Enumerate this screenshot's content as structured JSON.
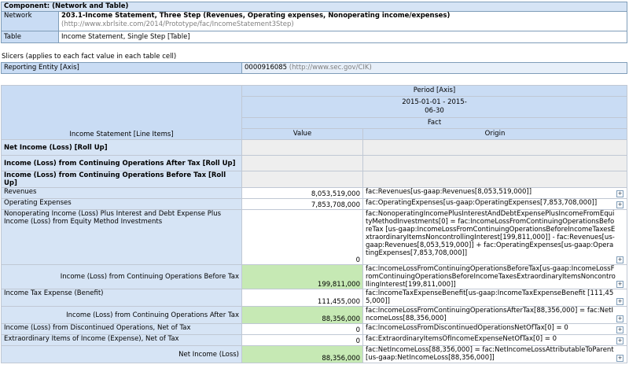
{
  "component": {
    "header": "Component: (Network and Table)",
    "network_label": "Network",
    "network_title": "203.1-Income Statement, Three Step (Revenues, Operating expenses, Nonoperating income/expenses)",
    "network_url": "(http://www.xbrlsite.com/2014/Prototype/fac/IncomeStatement3Step)",
    "table_label": "Table",
    "table_value": "Income Statement, Single Step [Table]"
  },
  "slicers": {
    "caption": "Slicers (applies to each fact value in each table cell)",
    "axis_label": "Reporting Entity [Axis]",
    "axis_value": "0000916085",
    "axis_value_url": "(http://www.sec.gov/CIK)"
  },
  "grid": {
    "period_axis": "Period [Axis]",
    "period_value": "2015-01-01 - 2015-06-30",
    "fact_label": "Fact",
    "line_items_label": "Income Statement [Line Items]",
    "value_col": "Value",
    "origin_col": "Origin",
    "rows": [
      {
        "label": "Net Income (Loss) [Roll Up]",
        "bold": true,
        "abstract": true,
        "value": "",
        "origin": ""
      },
      {
        "label": "Income (Loss) from Continuing Operations After Tax [Roll Up]",
        "bold": true,
        "abstract": true,
        "value": "",
        "origin": ""
      },
      {
        "label": "Income (Loss) from Continuing Operations Before Tax [Roll Up]",
        "bold": true,
        "abstract": true,
        "value": "",
        "origin": ""
      },
      {
        "label": "Revenues",
        "value": "8,053,519,000",
        "origin": "fac:Revenues[us-gaap:Revenues[8,053,519,000]]"
      },
      {
        "label": "Operating Expenses",
        "value": "7,853,708,000",
        "origin": "fac:OperatingExpenses[us-gaap:OperatingExpenses[7,853,708,000]]"
      },
      {
        "label": "Nonoperating Income (Loss) Plus Interest and Debt Expense Plus Income (Loss) from Equity Method Investments",
        "value": "0",
        "origin": "fac:NonoperatingIncomePlusInterestAndDebtExpensePlusIncomeFromEquityMethodInvestments[0] = fac:IncomeLossFromContinuingOperationsBeforeTax [us-gaap:IncomeLossFromContinuingOperationsBeforeIncomeTaxesExtraordinaryItemsNoncontrollingInterest[199,811,000]] - fac:Revenues[us-gaap:Revenues[8,053,519,000]] + fac:OperatingExpenses[us-gaap:OperatingExpenses[7,853,708,000]]"
      },
      {
        "label": "Income (Loss) from Continuing Operations Before Tax",
        "indent": true,
        "total": true,
        "value": "199,811,000",
        "origin": "fac:IncomeLossFromContinuingOperationsBeforeTax[us-gaap:IncomeLossFromContinuingOperationsBeforeIncomeTaxesExtraordinaryItemsNoncontrollingInterest[199,811,000]]"
      },
      {
        "label": "Income Tax Expense (Benefit)",
        "value": "111,455,000",
        "origin": "fac:IncomeTaxExpenseBenefit[us-gaap:IncomeTaxExpenseBenefit [111,455,000]]"
      },
      {
        "label": "Income (Loss) from Continuing Operations After Tax",
        "indent": true,
        "total": true,
        "value": "88,356,000",
        "origin": "fac:IncomeLossFromContinuingOperationsAfterTax[88,356,000] = fac:NetIncomeLoss[88,356,000]"
      },
      {
        "label": "Income (Loss) from Discontinued Operations, Net of Tax",
        "value": "0",
        "origin": "fac:IncomeLossFromDiscontinuedOperationsNetOfTax[0] = 0"
      },
      {
        "label": "Extraordinary Items of Income (Expense), Net of Tax",
        "value": "0",
        "origin": "fac:ExtraordinaryItemsOfIncomeExpenseNetOfTax[0] = 0"
      },
      {
        "label": "Net Income (Loss)",
        "indent": true,
        "total": true,
        "value": "88,356,000",
        "origin": "fac:NetIncomeLoss[88,356,000] = fac:NetIncomeLossAttributableToParent [us-gaap:NetIncomeLoss[88,356,000]]"
      }
    ],
    "expand_icon": "plus-box-icon",
    "expand_glyph": "+"
  },
  "colors": {
    "header_bg": "#c9dcf4",
    "total_value_bg": "#c6e9b4",
    "abstract_bg": "#eeeeee"
  }
}
